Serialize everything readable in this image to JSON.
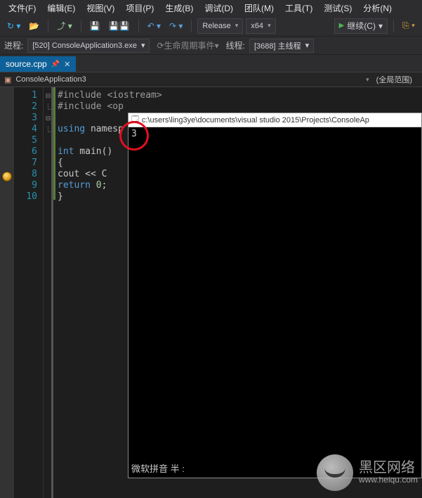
{
  "menu": {
    "file": "文件(F)",
    "edit": "编辑(E)",
    "view": "视图(V)",
    "project": "项目(P)",
    "build": "生成(B)",
    "debug": "调试(D)",
    "team": "团队(M)",
    "tools": "工具(T)",
    "test": "测试(S)",
    "analyze": "分析(N)"
  },
  "toolbar": {
    "config": "Release",
    "platform": "x64",
    "continue": "继续(C)"
  },
  "process": {
    "label": "进程:",
    "value": "[520] ConsoleApplication3.exe",
    "lifecycle": "生命周期事件",
    "thread_label": "线程:",
    "thread_value": "[3688] 主线程"
  },
  "tab": {
    "name": "source.cpp"
  },
  "navbar": {
    "project": "ConsoleApplication3",
    "scope": "(全局范围)"
  },
  "code": {
    "lines": [
      "1",
      "2",
      "3",
      "4",
      "5",
      "6",
      "7",
      "8",
      "9",
      "10"
    ],
    "l1": "#include <iostream>",
    "l2a": "#include <op",
    "l4a": "using",
    "l4b": " namesp",
    "l6a": "int",
    "l6b": " main()",
    "l7": "{",
    "l8a": "    cout << C",
    "l9a": "    return",
    "l9b": " 0",
    "l10": "}"
  },
  "console": {
    "icon": "cmd-icon",
    "title": "c:\\users\\ling3ye\\documents\\visual studio 2015\\Projects\\ConsoleAp",
    "output": "3",
    "ime": "微软拼音  半  :"
  },
  "watermark": {
    "line1": "黑区网络",
    "line2": "www.heiqu.com"
  }
}
